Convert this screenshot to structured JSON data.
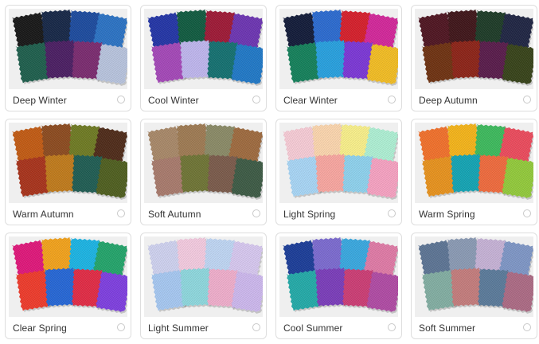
{
  "palettes": [
    {
      "label": "Deep Winter",
      "colors": [
        "#161616",
        "#152646",
        "#1b4a9e",
        "#2a72c4",
        "#1d5e4c",
        "#4a1d62",
        "#7a2a6f",
        "#b8c4de"
      ]
    },
    {
      "label": "Cool Winter",
      "colors": [
        "#2234a6",
        "#0f5a3f",
        "#9e1835",
        "#6c34b2",
        "#a447b8",
        "#bfb6ee",
        "#137070",
        "#1f78c7"
      ]
    },
    {
      "label": "Clear Winter",
      "colors": [
        "#111a38",
        "#2a6ad0",
        "#d61e2a",
        "#d3269a",
        "#13805a",
        "#26a0df",
        "#7b36d6",
        "#f3bd22"
      ]
    },
    {
      "label": "Deep Autumn",
      "colors": [
        "#4e1420",
        "#3e1418",
        "#1c3a26",
        "#1e2442",
        "#6e3110",
        "#8c2216",
        "#581a4a",
        "#364218"
      ]
    },
    {
      "label": "Warm Autumn",
      "colors": [
        "#c25a12",
        "#8c4a1e",
        "#6e7a22",
        "#4e2a18",
        "#a8321a",
        "#c07a1a",
        "#1e5c52",
        "#4e5e1e"
      ]
    },
    {
      "label": "Soft Autumn",
      "colors": [
        "#a88868",
        "#9e7a52",
        "#8a8a66",
        "#9e6a3e",
        "#a87a6c",
        "#6e7434",
        "#7a5a4a",
        "#3c5a44"
      ]
    },
    {
      "label": "Light Spring",
      "colors": [
        "#f7ccd6",
        "#fcd6ae",
        "#f9f08a",
        "#aef0d4",
        "#a8d6f6",
        "#f9a6a0",
        "#8ed2ee",
        "#f7a2c2"
      ]
    },
    {
      "label": "Warm Spring",
      "colors": [
        "#f2702a",
        "#f5b418",
        "#3cba5c",
        "#ec4a5c",
        "#e8921c",
        "#12a4b4",
        "#f06a3c",
        "#92ca3a"
      ]
    },
    {
      "label": "Clear Spring",
      "colors": [
        "#e0167a",
        "#f3a21a",
        "#1ab4e4",
        "#22a46a",
        "#ef3a2a",
        "#2466d6",
        "#e22a44",
        "#7e3ee0"
      ]
    },
    {
      "label": "Light Summer",
      "colors": [
        "#cfd2f0",
        "#f4cbe0",
        "#bfd6f4",
        "#d7c8f0",
        "#a6c8f2",
        "#8ed8de",
        "#f0aecc",
        "#cdb8ee"
      ]
    },
    {
      "label": "Cool Summer",
      "colors": [
        "#1a3c98",
        "#7b6ad0",
        "#38a8e0",
        "#e07aa6",
        "#22aaa8",
        "#7a3cba",
        "#cc3c74",
        "#b04aa4"
      ]
    },
    {
      "label": "Soft Summer",
      "colors": [
        "#5c7494",
        "#8a9ab4",
        "#c6b2d6",
        "#7e96c6",
        "#82aea2",
        "#c47c7c",
        "#5a7a9a",
        "#ac6a84"
      ]
    }
  ]
}
